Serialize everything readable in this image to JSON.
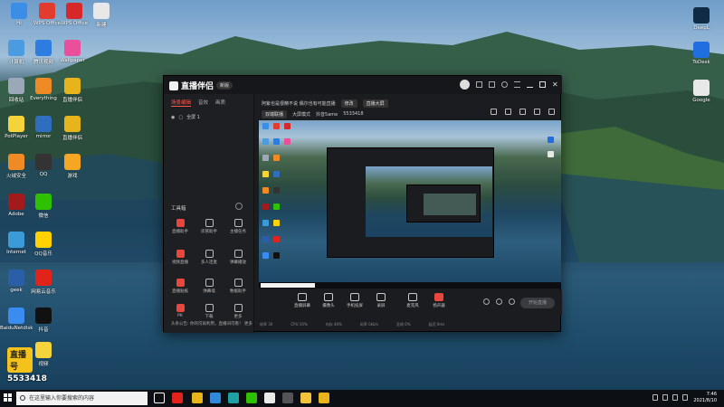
{
  "desktop": {
    "icons_left": [
      {
        "label": "Hi",
        "name": "hi-icon",
        "color": "#3a8ee6"
      },
      {
        "label": "WPS Office",
        "name": "wps-office-icon",
        "color": "#e23c2f"
      },
      {
        "label": "WPS Office",
        "name": "wps-office-2-icon",
        "color": "#d62828"
      },
      {
        "label": "新建",
        "name": "new-file-icon",
        "color": "#e8e8e8"
      },
      {
        "label": "计算机",
        "name": "computer-icon",
        "color": "#4b9be0"
      },
      {
        "label": "腾讯视频",
        "name": "tencent-video-icon",
        "color": "#2d7de0"
      },
      {
        "label": "Wallpaper",
        "name": "wallpaper-icon",
        "color": "#e94f9b"
      },
      {
        "label": "回收站",
        "name": "recycle-bin-icon",
        "color": "#9aa8b8"
      },
      {
        "label": "Everything",
        "name": "everything-icon",
        "color": "#f08a24"
      },
      {
        "label": "直播伴侣",
        "name": "live-companion-icon",
        "color": "#e8b41c"
      },
      {
        "label": "PotPlayer",
        "name": "potplayer-icon",
        "color": "#f5d33a"
      },
      {
        "label": "mirror",
        "name": "mirror-icon",
        "color": "#2f6ebf"
      },
      {
        "label": "直播伴侣",
        "name": "live-companion-2-icon",
        "color": "#e8b41c"
      },
      {
        "label": "火绒安全",
        "name": "huorong-icon",
        "color": "#f08a24"
      },
      {
        "label": "QQ",
        "name": "qq-icon",
        "color": "#333333"
      },
      {
        "label": "游戏",
        "name": "game-icon",
        "color": "#f5a623"
      },
      {
        "label": "Adobe",
        "name": "adobe-icon",
        "color": "#a21a1a"
      },
      {
        "label": "微信",
        "name": "wechat-icon",
        "color": "#2dc100"
      },
      {
        "label": "Internet",
        "name": "internet-icon",
        "color": "#3a9bd8"
      },
      {
        "label": "QQ音乐",
        "name": "qq-music-icon",
        "color": "#ffd200"
      },
      {
        "label": "geek",
        "name": "geek-icon",
        "color": "#2a5fa8"
      },
      {
        "label": "网易云音乐",
        "name": "netease-music-icon",
        "color": "#e2231a"
      },
      {
        "label": "BaiduNetdisk",
        "name": "baidu-netdisk-icon",
        "color": "#3b8cf0"
      },
      {
        "label": "抖音",
        "name": "douyin-icon",
        "color": "#111111"
      },
      {
        "label": "Fiddler",
        "name": "fiddler-icon",
        "color": "#2a7fd5"
      },
      {
        "label": "视频",
        "name": "video-icon",
        "color": "#f5d33a"
      }
    ],
    "icons_right": [
      {
        "label": "DeepL",
        "name": "deepl-icon",
        "color": "#0f2b46"
      },
      {
        "label": "ToDesk",
        "name": "todesk-icon",
        "color": "#1f6fe0"
      },
      {
        "label": "Google",
        "name": "google-icon",
        "color": "#e8e8e8"
      }
    ],
    "promo": {
      "head": "直播号",
      "number": "5533418"
    }
  },
  "app": {
    "title": "直播伴侣",
    "version": "新版",
    "tabs": [
      "场景编辑",
      "音效",
      "画质"
    ],
    "scene_label": "全屏 1",
    "tools_title": "工具箱",
    "tools": [
      {
        "label": "直播助手",
        "icon": "live-helper-icon",
        "red": true
      },
      {
        "label": "房管助手",
        "icon": "room-admin-icon",
        "red": false
      },
      {
        "label": "主播任务",
        "icon": "anchor-task-icon",
        "red": false
      },
      {
        "label": "视频直播",
        "icon": "video-live-icon",
        "red": true
      },
      {
        "label": "多人连麦",
        "icon": "multi-mic-icon",
        "red": false
      },
      {
        "label": "弹幕播放",
        "icon": "danmu-play-icon",
        "red": false
      },
      {
        "label": "直播贴纸",
        "icon": "sticker-icon",
        "red": true
      },
      {
        "label": "弹幕墙",
        "icon": "danmu-wall-icon",
        "red": false
      },
      {
        "label": "数据助手",
        "icon": "data-helper-icon",
        "red": false
      },
      {
        "label": "PK",
        "icon": "pk-icon",
        "red": true
      },
      {
        "label": "下载",
        "icon": "download-icon",
        "red": false
      },
      {
        "label": "更多",
        "icon": "more-icon",
        "red": false
      }
    ],
    "notice": "头条公告: 你的可再利用，直播间可看！ 更多",
    "room_title": "阿紫也是很精不说 偶尔也有可能直播",
    "room_tag": "修改",
    "room_tag2": "直播大屏",
    "room_meta": [
      "双端联播",
      "大屏模式",
      "抖音5ame",
      "5533418"
    ],
    "bottom_controls": [
      {
        "label": "直播屏幕",
        "icon": "screen-icon",
        "red": false
      },
      {
        "label": "摄像头",
        "icon": "camera-icon",
        "red": false
      },
      {
        "label": "手机投屏",
        "icon": "phone-cast-icon",
        "red": false
      },
      {
        "label": "录屏",
        "icon": "record-icon",
        "red": false
      },
      {
        "label": "麦克风",
        "icon": "mic-icon",
        "red": false
      },
      {
        "label": "扬声器",
        "icon": "speaker-icon",
        "red": true
      }
    ],
    "go_live": "开始直播",
    "status": [
      "帧率 30",
      "CPU 10%",
      "内存 40%",
      "码率 0kb/s",
      "丢帧 0%",
      "延迟 0ms"
    ]
  },
  "taskbar": {
    "search_placeholder": "在这里输入你要搜索的内容",
    "apps": [
      {
        "name": "taskview-icon",
        "color": "#ffffff"
      },
      {
        "name": "recorder-icon",
        "color": "#e2231a"
      },
      {
        "name": "live-companion-taskbar-icon",
        "color": "#e8b41c"
      },
      {
        "name": "browser-icon",
        "color": "#2f88d8"
      },
      {
        "name": "edge-icon",
        "color": "#1fa1a3"
      },
      {
        "name": "wechat-taskbar-icon",
        "color": "#2dc100"
      },
      {
        "name": "notes-icon",
        "color": "#eaeaea"
      },
      {
        "name": "terminal-icon",
        "color": "#555555"
      },
      {
        "name": "folder-icon",
        "color": "#f3c13a"
      },
      {
        "name": "settings-taskbar-icon",
        "color": "#e8b41c"
      }
    ],
    "time": "7:46",
    "date": "2021/8/10"
  }
}
